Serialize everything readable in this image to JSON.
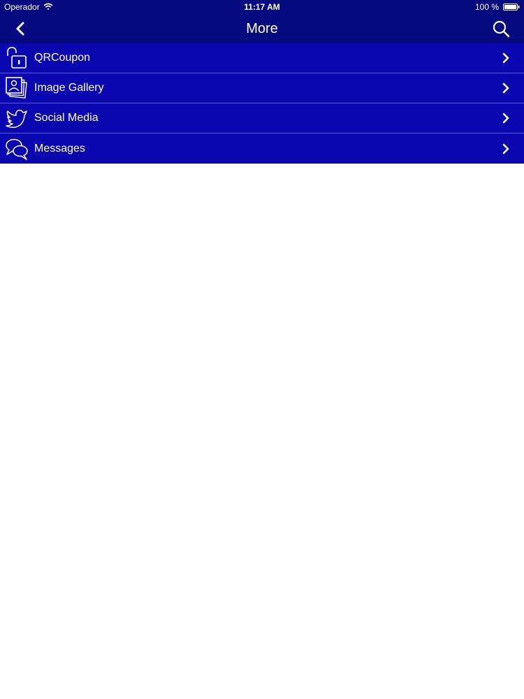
{
  "status_bar": {
    "carrier": "Operador",
    "time": "11:17 AM",
    "battery_percent": "100 %",
    "icons": [
      "wifi-icon",
      "battery-icon"
    ]
  },
  "nav": {
    "title": "More",
    "back_icon": "chevron-left-icon",
    "search_icon": "search-icon"
  },
  "menu": {
    "items": [
      {
        "label": "QRCoupon",
        "icon": "unlocked-padlock-icon"
      },
      {
        "label": "Image Gallery",
        "icon": "photo-gallery-icon"
      },
      {
        "label": "Social Media",
        "icon": "twitter-bird-icon"
      },
      {
        "label": "Messages",
        "icon": "speech-bubbles-icon"
      }
    ]
  },
  "colors": {
    "header_bg": "#050a7e",
    "menu_bg": "#0b07b0",
    "divider": "#5a5ad8",
    "text": "#ffffff"
  }
}
